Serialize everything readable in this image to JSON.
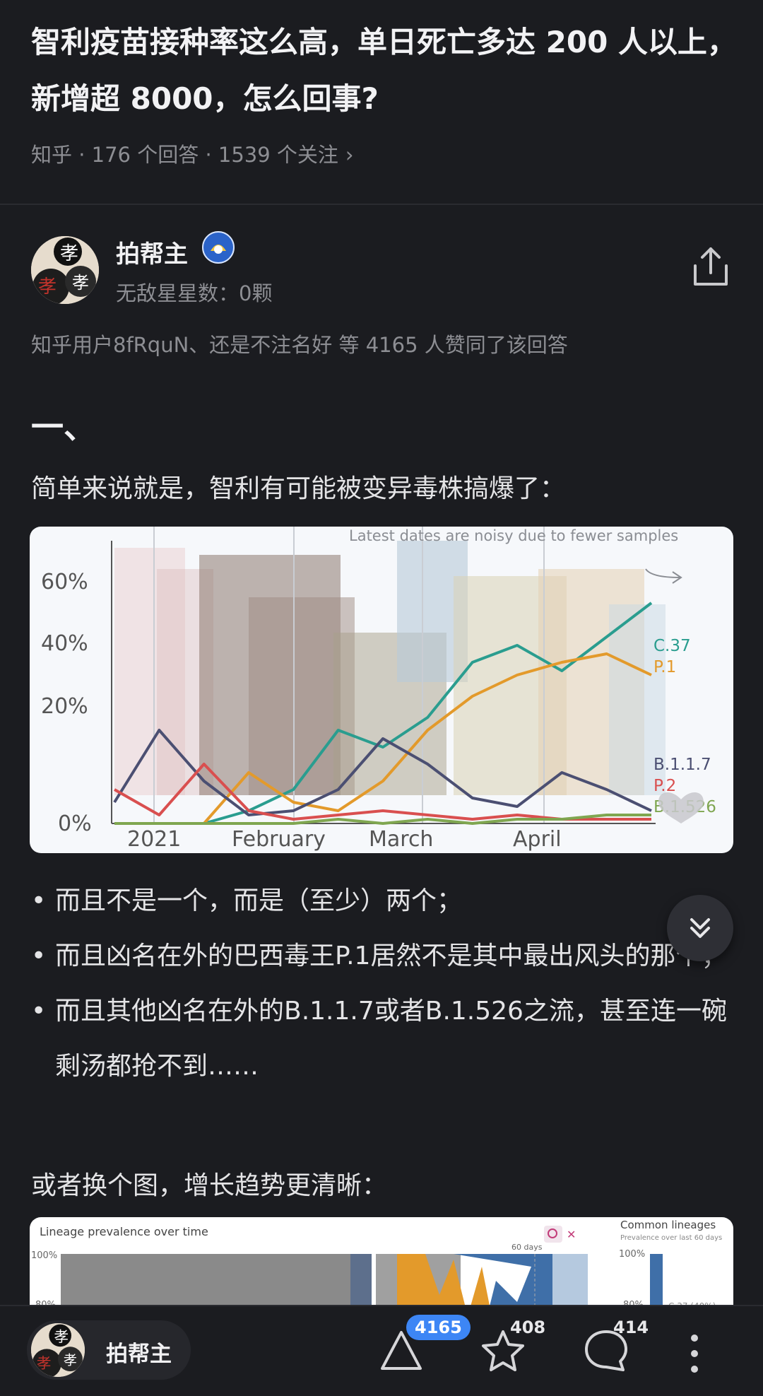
{
  "question": {
    "title": "智利疫苗接种率这么高，单日死亡多达 200 人以上，新增超 8000，怎么回事?",
    "meta": "知乎 · 176 个回答 · 1539 个关注",
    "meta_chevron": "›"
  },
  "author": {
    "name": "拍帮主",
    "sub": "无敌星星数：0颗",
    "avatar_text_top": "孝",
    "avatar_text_left": "孝",
    "avatar_text_right": "孝"
  },
  "votes_line": "知乎用户8fRquN、还是不注名好 等 4165 人赞同了该回答",
  "content": {
    "heading": "一、",
    "para1": "简单来说就是，智利有可能被变异毒株搞爆了：",
    "bullets": [
      "而且不是一个，而是（至少）两个；",
      "而且凶名在外的巴西毒王P.1居然不是其中最出风头的那个；",
      "而且其他凶名在外的B.1.1.7或者B.1.526之流，甚至连一碗剩汤都抢不到……"
    ],
    "para2": "或者换个图，增长趋势更清晰："
  },
  "chart_data": [
    {
      "type": "line",
      "title": "",
      "annotation": "Latest dates are noisy due to fewer samples",
      "x_ticks": [
        "2021",
        "February",
        "March",
        "April"
      ],
      "y_ticks": [
        "60%",
        "40%",
        "20%",
        "0%"
      ],
      "ylim": [
        0,
        70
      ],
      "grid": false,
      "legend_position": "right",
      "x": [
        0,
        10,
        20,
        30,
        40,
        50,
        60,
        70,
        80,
        90,
        100,
        110,
        120
      ],
      "series": [
        {
          "name": "C.37",
          "color": "#2a9d8f",
          "values": [
            0,
            0,
            0,
            3,
            8,
            22,
            18,
            25,
            38,
            42,
            36,
            44,
            52
          ]
        },
        {
          "name": "P.1",
          "color": "#e39a2b",
          "values": [
            0,
            0,
            0,
            12,
            5,
            3,
            10,
            22,
            30,
            35,
            38,
            40,
            35
          ]
        },
        {
          "name": "B.1.1.7",
          "color": "#4b4f72",
          "values": [
            5,
            22,
            10,
            2,
            3,
            8,
            20,
            14,
            6,
            4,
            12,
            8,
            3
          ]
        },
        {
          "name": "P.2",
          "color": "#d94f4f",
          "values": [
            8,
            2,
            14,
            3,
            1,
            2,
            3,
            2,
            1,
            2,
            1,
            1,
            1
          ]
        },
        {
          "name": "B.1.526",
          "color": "#7fa650",
          "values": [
            0,
            0,
            0,
            0,
            0,
            1,
            0,
            1,
            0,
            1,
            1,
            2,
            2
          ]
        }
      ]
    },
    {
      "type": "area",
      "title": "Lineage prevalence over time",
      "side_title": "Common lineages",
      "side_subtitle": "Prevalence over last 60 days",
      "annotation": "60 days",
      "y_ticks": [
        "100%",
        "80%"
      ],
      "side_y_ticks": [
        "100%",
        "80%"
      ],
      "side_label": "C.37 (40%)"
    }
  ],
  "bottom_bar": {
    "name": "拍帮主",
    "upvotes": "4165",
    "favorites": "408",
    "comments": "414"
  },
  "colors": {
    "accent": "#3d86f5",
    "background": "#1b1c20"
  },
  "icons": [
    "share-icon",
    "expand-down-icon",
    "upvote-icon",
    "star-icon",
    "comment-icon",
    "more-icon"
  ]
}
